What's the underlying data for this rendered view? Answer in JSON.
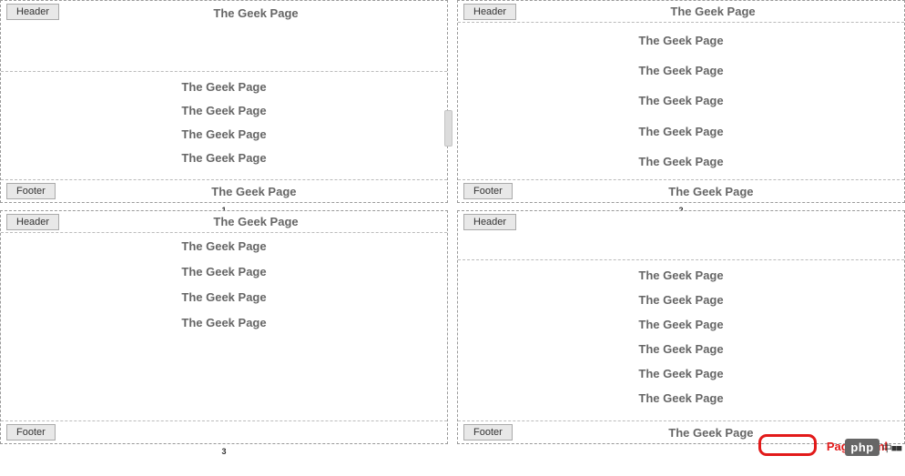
{
  "labels": {
    "header": "Header",
    "footer": "Footer"
  },
  "content_line": "The Geek Page",
  "pages": [
    {
      "number": "1",
      "header_text": "The Geek Page",
      "body_lines": [
        "The Geek Page",
        "The Geek Page",
        "The Geek Page",
        "The Geek Page"
      ],
      "footer_text": "The Geek Page"
    },
    {
      "number": "2",
      "header_text": "The Geek Page",
      "body_lines": [
        "The Geek Page",
        "The Geek Page",
        "The Geek Page",
        "The Geek Page",
        "The Geek Page"
      ],
      "footer_text": "The Geek Page"
    },
    {
      "number": "3",
      "header_text": "The Geek Page",
      "body_lines": [
        "The Geek Page",
        "The Geek Page",
        "The Geek Page",
        "The Geek Page"
      ],
      "footer_text": ""
    },
    {
      "number": "",
      "header_text": "",
      "body_lines": [
        "The Geek Page",
        "The Geek Page",
        "The Geek Page",
        "The Geek Page",
        "The Geek Page",
        "The Geek Page"
      ],
      "footer_text": "The Geek Page"
    }
  ],
  "callout": {
    "label": "Page Numl"
  },
  "badge": {
    "text": "php",
    "suffix": "中■■"
  }
}
